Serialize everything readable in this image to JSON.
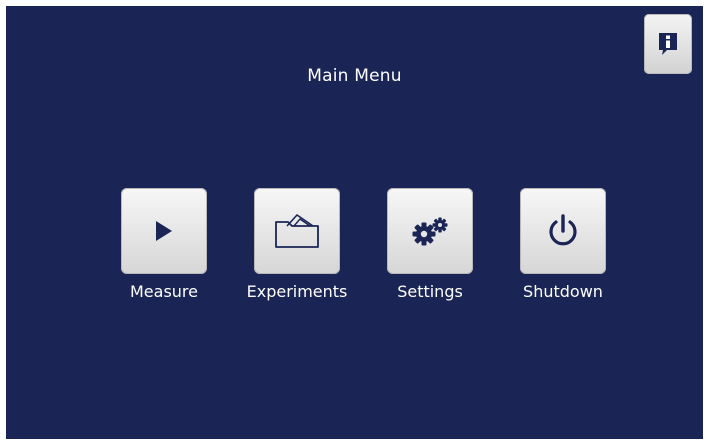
{
  "screen": {
    "title": "Main Menu",
    "background_color": "#1a2556",
    "button_color": "#e6e6e6",
    "icon_color": "#1a2556"
  },
  "info_button": {
    "icon": "info-icon"
  },
  "menu": [
    {
      "id": "measure",
      "label": "Measure",
      "icon": "play-icon"
    },
    {
      "id": "experiments",
      "label": "Experiments",
      "icon": "folder-icon"
    },
    {
      "id": "settings",
      "label": "Settings",
      "icon": "gears-icon"
    },
    {
      "id": "shutdown",
      "label": "Shutdown",
      "icon": "power-icon"
    }
  ]
}
